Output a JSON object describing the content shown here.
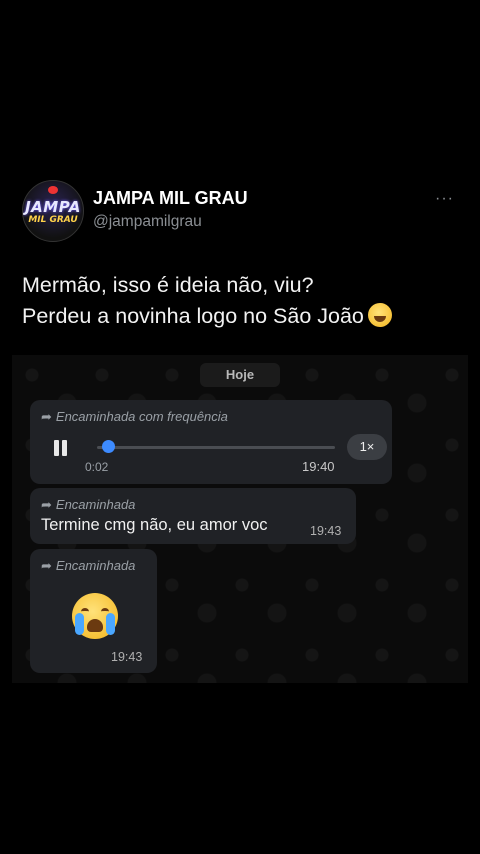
{
  "tweet": {
    "avatar_logo_line1": "JAMPA",
    "avatar_logo_line2": "MIL GRAU",
    "name": "JAMPA MIL GRAU",
    "handle": "@jampamilgrau",
    "more": "···",
    "text_line1": "Mermão, isso é ideia não, viu?",
    "text_line2": "Perdeu a novinha logo no São João",
    "text_emoji": "sweat-smile-emoji"
  },
  "chat": {
    "date_chip": "Hoje",
    "messages": [
      {
        "type": "audio",
        "forward_label": "Encaminhada com frequência",
        "elapsed": "0:02",
        "duration": "19:40",
        "speed": "1×",
        "progress": 0.05
      },
      {
        "type": "text",
        "forward_label": "Encaminhada",
        "text": "Termine cmg não, eu amor voc",
        "time": "19:43"
      },
      {
        "type": "emoji",
        "forward_label": "Encaminhada",
        "emoji": "loudly-crying-face",
        "time": "19:43"
      }
    ],
    "colors": {
      "bubble": "#202226",
      "accent": "#3d8bff"
    }
  }
}
